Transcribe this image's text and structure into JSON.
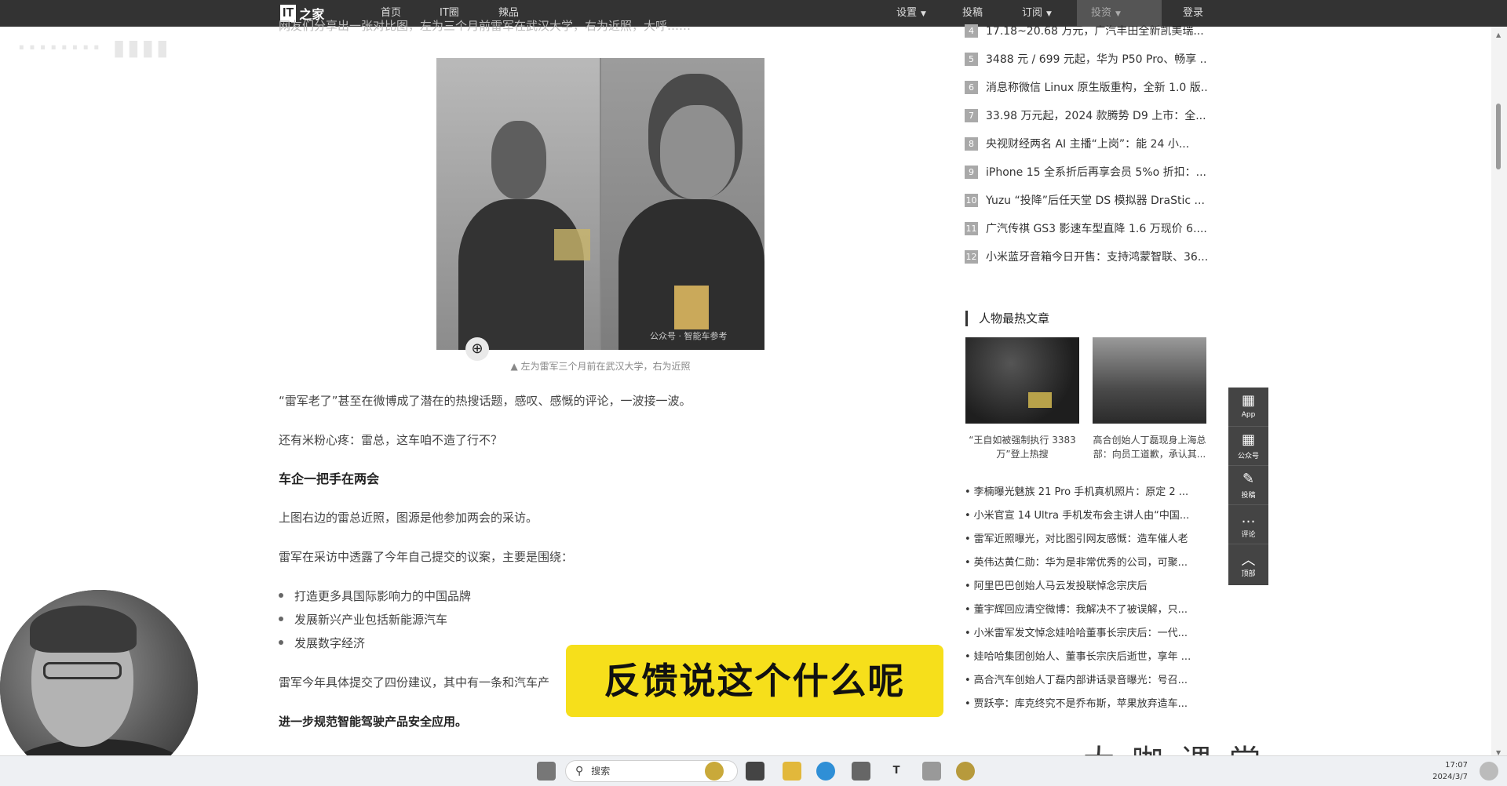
{
  "nav": {
    "logo_it": "IT",
    "logo_zh": "之家",
    "links": [
      "首页",
      "IT圈",
      "辣品"
    ],
    "right_links": [
      "设置",
      "投稿",
      "订阅",
      "投资",
      "登录"
    ]
  },
  "article": {
    "top_cut_text": "网友们分享出一张对比图，左为三个月前雷军在武汉大学，右为近照，大呼……",
    "photo_watermark": "公众号 · 智能车参考",
    "photo_caption": "▲ 左为雷军三个月前在武汉大学，右为近照",
    "p1": "“雷军老了”甚至在微博成了潜在的热搜话题，感叹、感慨的评论，一波接一波。",
    "p2": "还有米粉心疼：雷总，这车咱不造了行不？",
    "heading1": "车企一把手在两会",
    "p3": "上图右边的雷总近照，图源是他参加两会的采访。",
    "p4": "雷军在采访中透露了今年自己提交的议案，主要是围绕：",
    "bullets": [
      "打造更多具国际影响力的中国品牌",
      "发展新兴产业包括新能源汽车",
      "发展数字经济"
    ],
    "p5": "雷军今年具体提交了四份建议，其中有一条和汽车产",
    "heading2": "进一步规范智能驾驶产品安全应用。"
  },
  "ranking": [
    {
      "num": "4",
      "text": "17.18~20.68 万元，广汽丰田全新凯美瑞..."
    },
    {
      "num": "5",
      "text": "3488 元 / 699 元起，华为 P50 Pro、畅享 ..."
    },
    {
      "num": "6",
      "text": "消息称微信 Linux 原生版重构，全新 1.0 版..."
    },
    {
      "num": "7",
      "text": "33.98 万元起，2024 款腾势 D9 上市：全..."
    },
    {
      "num": "8",
      "text": "央视财经两名 AI 主播“上岗”：能 24 小..."
    },
    {
      "num": "9",
      "text": "iPhone 15 全系折后再享会员 5%o 折扣：..."
    },
    {
      "num": "10",
      "text": "Yuzu “投降”后任天堂 DS 模拟器 DraStic ..."
    },
    {
      "num": "11",
      "text": "广汽传祺 GS3 影速车型直降 1.6 万现价 6...."
    },
    {
      "num": "12",
      "text": "小米蓝牙音箱今日开售：支持鸿蒙智联、36..."
    }
  ],
  "hot": {
    "title": "人物最热文章",
    "cards": [
      {
        "caption": "“王自如被强制执行 3383 万”登上热搜"
      },
      {
        "caption": "高合创始人丁磊现身上海总部：向员工道歉，承认其..."
      }
    ],
    "items": [
      "李楠曝光魅族 21 Pro 手机真机照片：原定 2 ...",
      "小米官宣 14 Ultra 手机发布会主讲人由“中国...",
      "雷军近照曝光，对比图引网友感慨：造车催人老",
      "英伟达黄仁勋：华为是非常优秀的公司，可聚...",
      "阿里巴巴创始人马云发投联悼念宗庆后",
      "董宇辉回应清空微博：我解决不了被误解，只...",
      "小米雷军发文悼念娃哈哈董事长宗庆后：一代...",
      "娃哈哈集团创始人、董事长宗庆后逝世，享年 ...",
      "高合汽车创始人丁磊内部讲话录音曝光：号召...",
      "贾跃亭：库克终究不是乔布斯，苹果放弃造车..."
    ]
  },
  "floatbar": [
    {
      "icon": "▦",
      "label": "App"
    },
    {
      "icon": "▦",
      "label": "公众号"
    },
    {
      "icon": "✎",
      "label": "投稿"
    },
    {
      "icon": "…",
      "label": "评论"
    },
    {
      "icon": "︿",
      "label": "顶部"
    }
  ],
  "subtitle": "反馈说这个什么呢",
  "watermark_brand": "大咖课堂",
  "taskbar": {
    "search_placeholder": "搜索",
    "time": "17:07",
    "date": "2024/3/7"
  }
}
